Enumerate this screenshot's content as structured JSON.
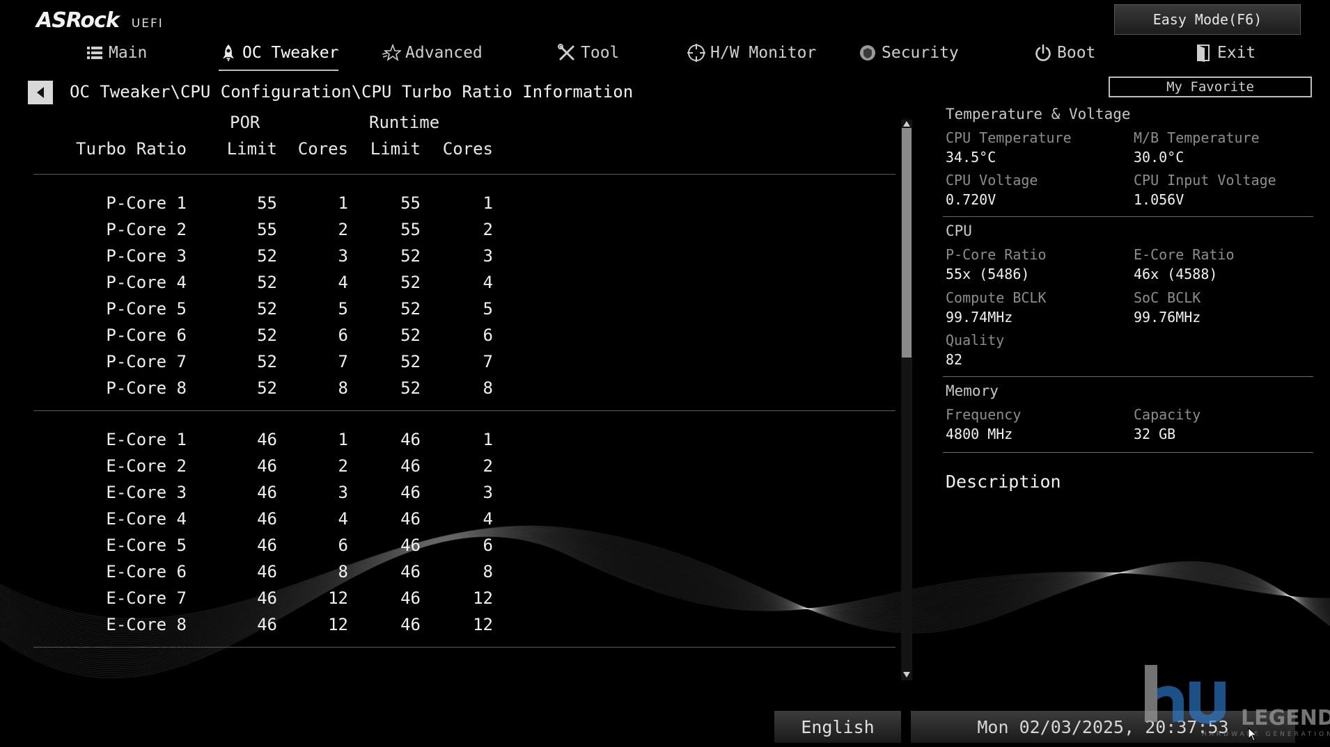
{
  "header": {
    "brand": "ASRock",
    "product": "UEFI",
    "easy_mode_label": "Easy Mode(F6)",
    "my_favorite_label": "My Favorite"
  },
  "nav": {
    "main": "Main",
    "oc_tweaker": "OC Tweaker",
    "advanced": "Advanced",
    "tool": "Tool",
    "hw_monitor": "H/W Monitor",
    "security": "Security",
    "boot": "Boot",
    "exit": "Exit"
  },
  "breadcrumb": "OC Tweaker\\CPU Configuration\\CPU Turbo Ratio Information",
  "table": {
    "group_por": "POR",
    "group_runtime": "Runtime",
    "col_turbo_ratio": "Turbo Ratio",
    "col_por_limit": "Limit",
    "col_por_cores": "Cores",
    "col_runtime_limit": "Limit",
    "col_runtime_cores": "Cores",
    "p_cores": [
      {
        "name": "P-Core 1",
        "por_limit": "55",
        "por_cores": "1",
        "rt_limit": "55",
        "rt_cores": "1"
      },
      {
        "name": "P-Core 2",
        "por_limit": "55",
        "por_cores": "2",
        "rt_limit": "55",
        "rt_cores": "2"
      },
      {
        "name": "P-Core 3",
        "por_limit": "52",
        "por_cores": "3",
        "rt_limit": "52",
        "rt_cores": "3"
      },
      {
        "name": "P-Core 4",
        "por_limit": "52",
        "por_cores": "4",
        "rt_limit": "52",
        "rt_cores": "4"
      },
      {
        "name": "P-Core 5",
        "por_limit": "52",
        "por_cores": "5",
        "rt_limit": "52",
        "rt_cores": "5"
      },
      {
        "name": "P-Core 6",
        "por_limit": "52",
        "por_cores": "6",
        "rt_limit": "52",
        "rt_cores": "6"
      },
      {
        "name": "P-Core 7",
        "por_limit": "52",
        "por_cores": "7",
        "rt_limit": "52",
        "rt_cores": "7"
      },
      {
        "name": "P-Core 8",
        "por_limit": "52",
        "por_cores": "8",
        "rt_limit": "52",
        "rt_cores": "8"
      }
    ],
    "e_cores": [
      {
        "name": "E-Core 1",
        "por_limit": "46",
        "por_cores": "1",
        "rt_limit": "46",
        "rt_cores": "1"
      },
      {
        "name": "E-Core 2",
        "por_limit": "46",
        "por_cores": "2",
        "rt_limit": "46",
        "rt_cores": "2"
      },
      {
        "name": "E-Core 3",
        "por_limit": "46",
        "por_cores": "3",
        "rt_limit": "46",
        "rt_cores": "3"
      },
      {
        "name": "E-Core 4",
        "por_limit": "46",
        "por_cores": "4",
        "rt_limit": "46",
        "rt_cores": "4"
      },
      {
        "name": "E-Core 5",
        "por_limit": "46",
        "por_cores": "6",
        "rt_limit": "46",
        "rt_cores": "6"
      },
      {
        "name": "E-Core 6",
        "por_limit": "46",
        "por_cores": "8",
        "rt_limit": "46",
        "rt_cores": "8"
      },
      {
        "name": "E-Core 7",
        "por_limit": "46",
        "por_cores": "12",
        "rt_limit": "46",
        "rt_cores": "12"
      },
      {
        "name": "E-Core 8",
        "por_limit": "46",
        "por_cores": "12",
        "rt_limit": "46",
        "rt_cores": "12"
      }
    ]
  },
  "monitor": {
    "temp_voltage": {
      "title": "Temperature & Voltage",
      "cpu_temp_label": "CPU Temperature",
      "cpu_temp_value": "34.5°C",
      "mb_temp_label": "M/B Temperature",
      "mb_temp_value": "30.0°C",
      "cpu_voltage_label": "CPU Voltage",
      "cpu_voltage_value": "0.720V",
      "cpu_input_voltage_label": "CPU Input Voltage",
      "cpu_input_voltage_value": "1.056V"
    },
    "cpu": {
      "title": "CPU",
      "pcore_ratio_label": "P-Core Ratio",
      "pcore_ratio_value": "55x (5486)",
      "ecore_ratio_label": "E-Core Ratio",
      "ecore_ratio_value": "46x (4588)",
      "compute_bclk_label": "Compute BCLK",
      "compute_bclk_value": "99.74MHz",
      "soc_bclk_label": "SoC BCLK",
      "soc_bclk_value": "99.76MHz",
      "quality_label": "Quality",
      "quality_value": "82"
    },
    "memory": {
      "title": "Memory",
      "frequency_label": "Frequency",
      "frequency_value": "4800 MHz",
      "capacity_label": "Capacity",
      "capacity_value": "32 GB"
    }
  },
  "description_title": "Description",
  "footer": {
    "language": "English",
    "datetime": "Mon 02/03/2025, 20:37:53"
  },
  "watermark": {
    "text": "LEGEND",
    "subtext": "HARDWARE GENERATION"
  },
  "icons": {
    "main": "list-icon",
    "oc_tweaker": "rocket-icon",
    "advanced": "star-icon",
    "tool": "tools-icon",
    "hw_monitor": "crosshair-icon",
    "security": "shield-icon",
    "boot": "power-icon",
    "exit": "exit-door-icon"
  },
  "colors": {
    "background": "#000000",
    "text": "#f0f0f0",
    "label": "#8d8d8d",
    "accent_watermark": "#2d7fd6"
  }
}
